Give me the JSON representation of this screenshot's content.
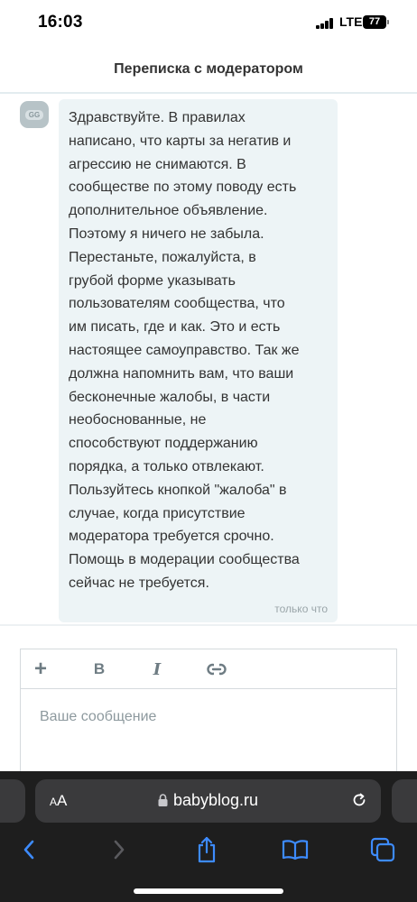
{
  "status_bar": {
    "time": "16:03",
    "network": "LTE",
    "battery": "77"
  },
  "header": {
    "title": "Переписка с модератором"
  },
  "message": {
    "avatar_initials": "GG",
    "text": "Здравствуйте. В правилах\nнаписано, что карты за негатив и\nагрессию не снимаются. В\nсообществе по этому поводу есть\nдополнительное объявление.\nПоэтому я ничего не забыла.\nПерестаньте, пожалуйста, в\nгрубой форме указывать\nпользователям сообщества, что\nим писать, где и как. Это и есть\nнастоящее самоуправство. Так же\nдолжна напомнить вам, что ваши\nбесконечные жалобы, в части\nнеобоснованные, не\nспособствуют поддержанию\nпорядка, а только отвлекают.\nПользуйтесь кнопкой \"жалоба\" в\nслучае, когда присутствие\nмодератора требуется срочно.\nПомощь в модерации сообщества\nсейчас не требуется.",
    "time": "только что"
  },
  "editor": {
    "toolbar": {
      "add_label": "+",
      "bold_label": "B",
      "italic_label": "I",
      "link_icon": "link-icon"
    },
    "input_value": "",
    "placeholder": "Ваше сообщение"
  },
  "browser": {
    "text_size_label_small": "A",
    "text_size_label_large": "A",
    "url": "babyblog.ru",
    "icons": [
      "lock-icon",
      "reload-icon",
      "back-icon",
      "forward-icon",
      "share-icon",
      "bookmarks-icon",
      "tabs-icon"
    ]
  },
  "colors": {
    "bubble_bg": "#edf4f6",
    "accent_blue": "#3d8bfd",
    "toolbar_icon": "#6e7c83"
  }
}
